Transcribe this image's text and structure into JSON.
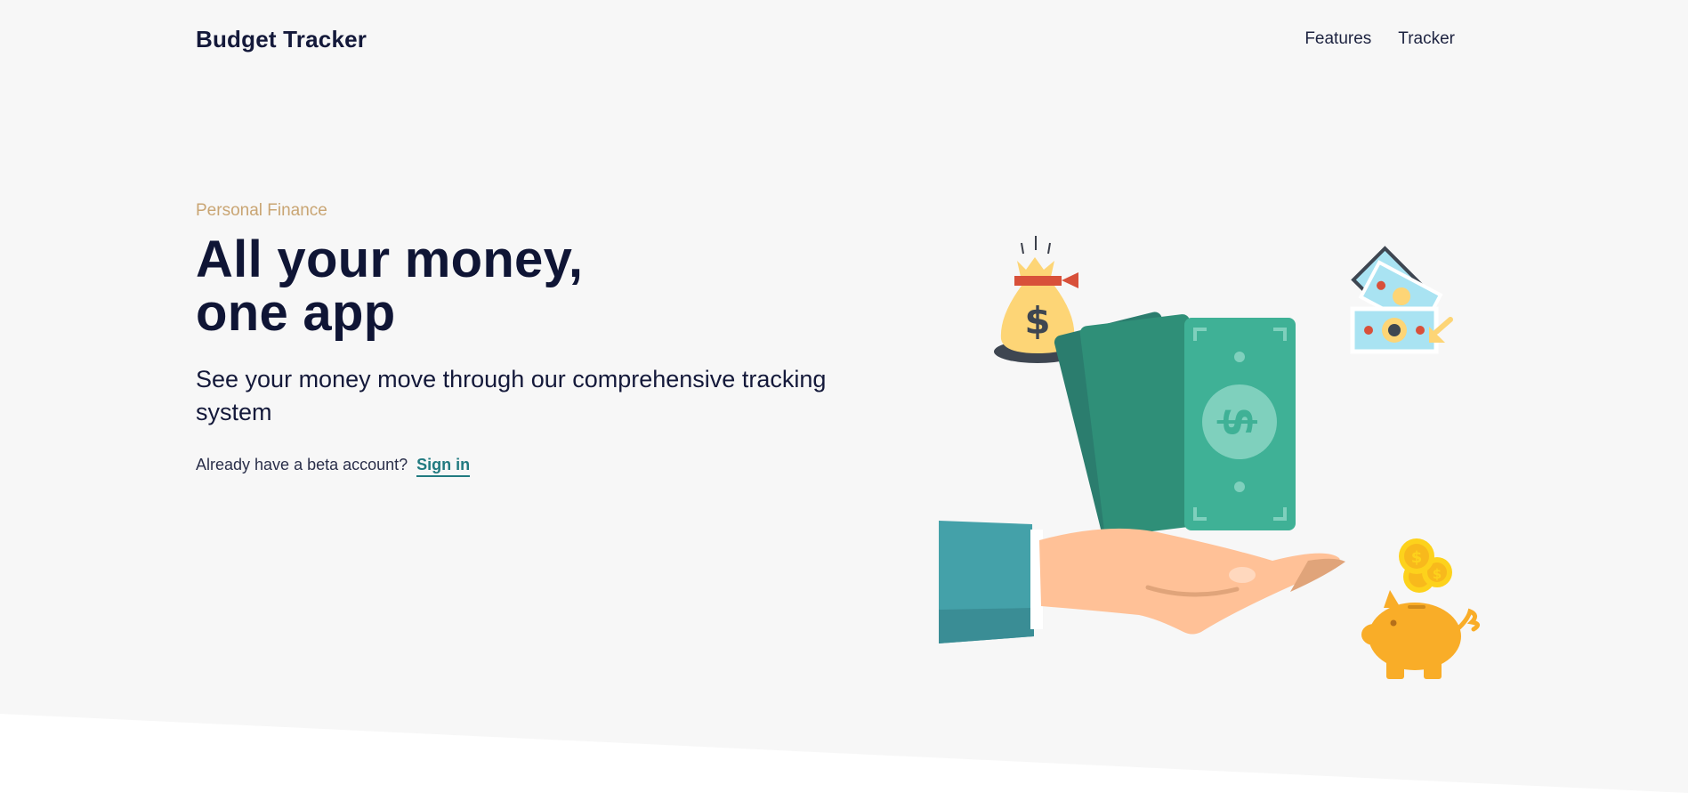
{
  "header": {
    "brand": "Budget Tracker",
    "nav": [
      {
        "label": "Features"
      },
      {
        "label": "Tracker"
      }
    ]
  },
  "hero": {
    "eyebrow": "Personal Finance",
    "headline_line1": "All your money,",
    "headline_line2": "one app",
    "subhead": "See your money move through our comprehensive tracking system",
    "signin_prompt": "Already have a beta account?",
    "signin_link": "Sign in"
  },
  "illustration": {
    "icons": [
      "money-bag-icon",
      "cash-bills-icon",
      "banknote-stack-icon",
      "open-hand-icon",
      "piggy-bank-icon",
      "gold-coins-icon"
    ]
  },
  "colors": {
    "background": "#f7f7f7",
    "navy": "#0f1535",
    "accent_gold": "#c9a573",
    "link_teal": "#217a80",
    "bill_green": "#3fb196"
  }
}
